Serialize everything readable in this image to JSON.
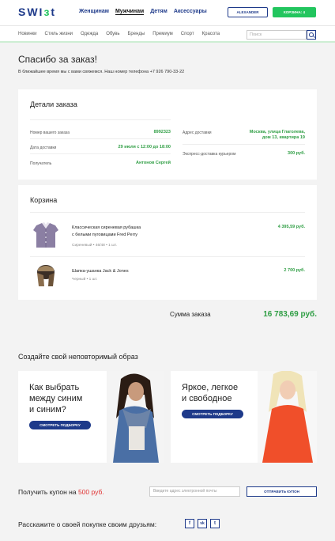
{
  "header": {
    "logo_left": "SWI",
    "logo_accent": "з",
    "logo_right": "t",
    "nav": [
      "Женщинам",
      "Мужчинам",
      "Детям",
      "Аксессуары"
    ],
    "account_label": "ALEXANDER",
    "cart_label": "КОРЗИНА: 4"
  },
  "categories": [
    "Новинки",
    "Стиль жизни",
    "Одежда",
    "Обувь",
    "Бренды",
    "Премиум",
    "Спорт",
    "Красота"
  ],
  "search": {
    "placeholder": "Поиск"
  },
  "thanks": {
    "title": "Спасибо за заказ!",
    "subtitle": "В ближайшее время мы с вами свяжемся. Наш номер телефона +7 926 790-33-22"
  },
  "order": {
    "title": "Детали заказа",
    "left": [
      {
        "label": "Номер вашего заказа",
        "value": "8992323"
      },
      {
        "label": "Дата доставки",
        "value": "29 июля с 12:00 до 18:00"
      },
      {
        "label": "Получатель",
        "value": "Антонов Сергей"
      }
    ],
    "right": [
      {
        "label": "Адрес доставки",
        "value1": "Москва, улица Глаголева,",
        "value2": "дом 13, квартира 19"
      },
      {
        "label": "Экспресс-доставка курьером",
        "value": "300 руб."
      }
    ]
  },
  "basket": {
    "title": "Корзина",
    "items": [
      {
        "name1": "Классическая сиреневая рубашка",
        "name2": "с белыми пуговицами Fred Perry",
        "meta": "Сиреневый  •  46/48  •  1 шт.",
        "price": "4 395,59 руб."
      },
      {
        "name1": "Шапка-ушанка Jack & Jones",
        "name2": "",
        "meta": "Черный  •  1 шт.",
        "price": "2 700 руб."
      }
    ]
  },
  "summary": {
    "label": "Сумма заказа",
    "value": "16 783,69 руб."
  },
  "promo": {
    "title": "Создайте свой неповторимый образ",
    "cards": [
      {
        "line1": "Как выбрать",
        "line2": "между синим",
        "line3": "и синим?",
        "button": "СМОТРЕТЬ ПОДБОРКУ"
      },
      {
        "line1": "Яркое, легкое",
        "line2": "и свободное",
        "line3": "",
        "button": "СМОТРЕТЬ ПОДБОРКУ"
      }
    ]
  },
  "coupon": {
    "label_prefix": "Получить купон на ",
    "label_amount": "500 руб.",
    "placeholder": "Введите адрес электронной почты",
    "button": "ОТПРАВИТЬ КУПОН"
  },
  "share": {
    "label": "Расскажите о своей покупке своим друзьям:",
    "icons": [
      "f",
      "vk",
      "t"
    ]
  },
  "colors": {
    "brand": "#1e3a8a",
    "accent": "#22c55e",
    "price": "#2f9e44",
    "coupon": "#e03131"
  }
}
